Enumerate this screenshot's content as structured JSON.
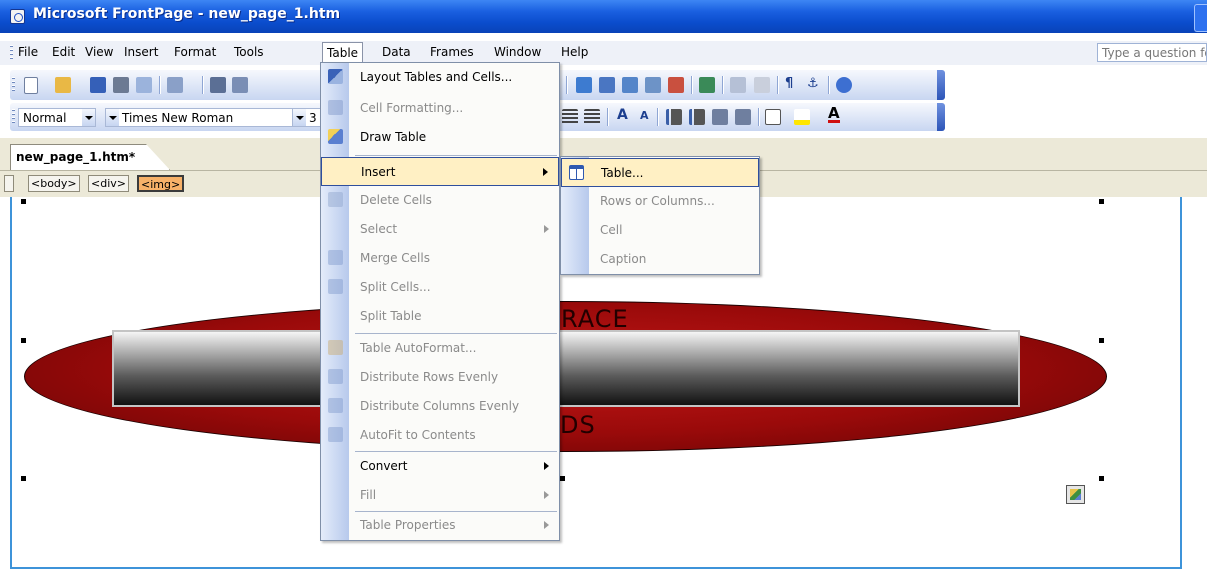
{
  "window": {
    "title": "Microsoft FrontPage - new_page_1.htm"
  },
  "menubar": {
    "items": [
      "File",
      "Edit",
      "View",
      "Insert",
      "Format",
      "Tools",
      "Table",
      "Data",
      "Frames",
      "Window",
      "Help"
    ],
    "question_placeholder": "Type a question fo"
  },
  "formatting": {
    "style": "Normal",
    "font": "Times New Roman",
    "size_fragment": "3"
  },
  "doc_tab": {
    "label": "new_page_1.htm*"
  },
  "tag_selector": {
    "tags": [
      "<body>",
      "<div>",
      "<img>"
    ]
  },
  "canvas_text": {
    "top_fragment": "RACE",
    "bottom_fragment": "DS"
  },
  "table_menu": {
    "items": [
      {
        "label": "Layout Tables and Cells...",
        "enabled": true,
        "icon": "layout-tables-icon"
      },
      {
        "label": "Cell Formatting...",
        "enabled": false,
        "icon": "cell-formatting-icon"
      },
      {
        "label": "Draw Table",
        "enabled": true,
        "icon": "draw-table-icon"
      },
      {
        "label": "Insert",
        "enabled": true,
        "submenu": true,
        "highlighted": true
      },
      {
        "label": "Delete Cells",
        "enabled": false,
        "icon": "delete-cells-icon"
      },
      {
        "label": "Select",
        "enabled": false,
        "submenu": true
      },
      {
        "label": "Merge Cells",
        "enabled": false,
        "icon": "merge-cells-icon"
      },
      {
        "label": "Split Cells...",
        "enabled": false,
        "icon": "split-cells-icon"
      },
      {
        "label": "Split Table",
        "enabled": false
      },
      {
        "label": "Table AutoFormat...",
        "enabled": false,
        "icon": "autoformat-icon"
      },
      {
        "label": "Distribute Rows Evenly",
        "enabled": false,
        "icon": "distribute-rows-icon"
      },
      {
        "label": "Distribute Columns Evenly",
        "enabled": false,
        "icon": "distribute-columns-icon"
      },
      {
        "label": "AutoFit to Contents",
        "enabled": false,
        "icon": "autofit-icon"
      },
      {
        "label": "Convert",
        "enabled": true,
        "submenu": true
      },
      {
        "label": "Fill",
        "enabled": false,
        "submenu": true
      },
      {
        "label": "Table Properties",
        "enabled": false,
        "submenu": true
      }
    ]
  },
  "insert_submenu": {
    "items": [
      {
        "label": "Table...",
        "enabled": true,
        "highlighted": true,
        "icon": "table-icon"
      },
      {
        "label": "Rows or Columns...",
        "enabled": false
      },
      {
        "label": "Cell",
        "enabled": false
      },
      {
        "label": "Caption",
        "enabled": false
      }
    ]
  },
  "colors": {
    "titlebar": "#0a4ccc",
    "highlight": "#fff0c4",
    "highlight_border": "#2f4f9d",
    "page_border": "#3d93d9",
    "ellipse": "#9a0a0a"
  }
}
